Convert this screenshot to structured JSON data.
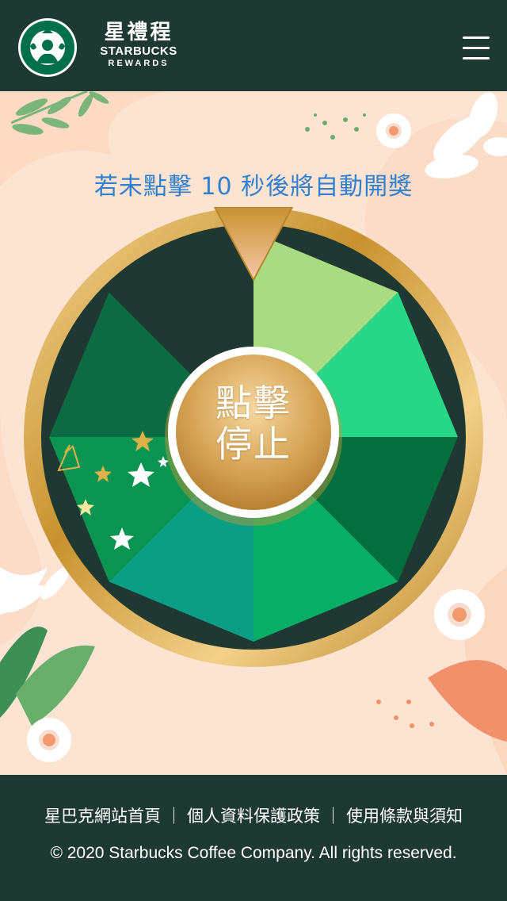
{
  "header": {
    "brand_cn": "星禮程",
    "brand_en": "STARBUCKS",
    "brand_rewards": "REWARDS",
    "menu_icon": "hamburger-menu-icon",
    "logo_icon": "starbucks-siren-logo"
  },
  "game": {
    "countdown_text": "若未點擊 10 秒後將自動開獎",
    "stop_button_line1": "點擊",
    "stop_button_line2": "停止",
    "segments": [
      "#a9dc82",
      "#27d787",
      "#046e3f",
      "#08ae67",
      "#0a9e84",
      "#099452",
      "#0d6b43",
      "#1f3932"
    ]
  },
  "footer": {
    "link_home": "星巴克網站首頁",
    "link_privacy": "個人資料保護政策",
    "link_terms": "使用條款與須知",
    "separator": "｜",
    "copyright": "© 2020 Starbucks Coffee Company. All rights reserved."
  },
  "colors": {
    "header_bg": "#1e3932",
    "page_bg": "#fbdcc8",
    "countdown_text": "#2f80d0",
    "gold": "#c89a3c"
  }
}
